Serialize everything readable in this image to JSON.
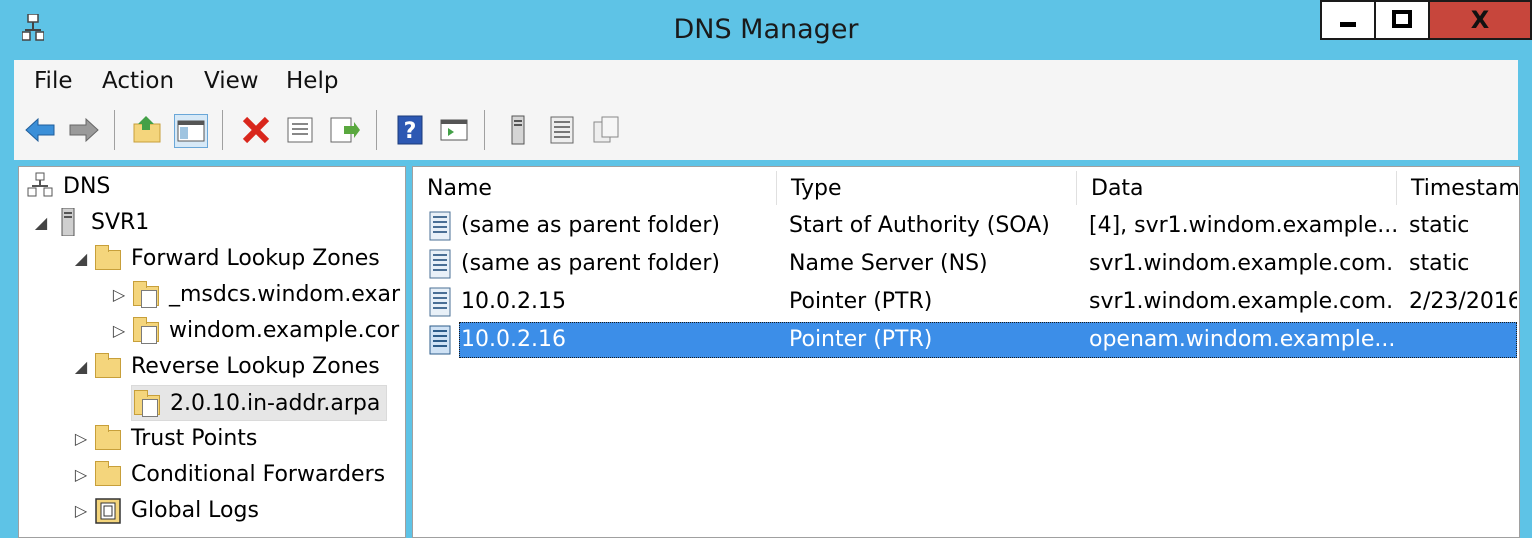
{
  "window": {
    "title": "DNS Manager",
    "min_label": "▬",
    "max_label": "☐",
    "close_label": "X"
  },
  "menu": [
    "File",
    "Action",
    "View",
    "Help"
  ],
  "toolbar": {
    "icons": [
      "back-arrow-icon",
      "forward-arrow-icon",
      "up-folder-icon",
      "show-hide-console-tree-icon",
      "delete-icon",
      "properties-icon",
      "export-list-icon",
      "help-icon",
      "action-pane-icon",
      "server-icon",
      "record-list-icon",
      "copy-icon"
    ]
  },
  "tree": {
    "root": "DNS",
    "server": "SVR1",
    "forward_zones": "Forward Lookup Zones",
    "forward_children": [
      "_msdcs.windom.exar",
      "windom.example.cor"
    ],
    "reverse_zones": "Reverse Lookup Zones",
    "reverse_children": [
      "2.0.10.in-addr.arpa"
    ],
    "trust_points": "Trust Points",
    "conditional_forwarders": "Conditional Forwarders",
    "global_logs": "Global Logs"
  },
  "list": {
    "columns": [
      "Name",
      "Type",
      "Data",
      "Timestam"
    ],
    "rows": [
      {
        "name": "(same as parent folder)",
        "type": "Start of Authority (SOA)",
        "data": "[4], svr1.windom.example....",
        "timestamp": "static"
      },
      {
        "name": "(same as parent folder)",
        "type": "Name Server (NS)",
        "data": "svr1.windom.example.com.",
        "timestamp": "static"
      },
      {
        "name": "10.0.2.15",
        "type": "Pointer (PTR)",
        "data": "svr1.windom.example.com.",
        "timestamp": "2/23/2016"
      },
      {
        "name": "10.0.2.16",
        "type": "Pointer (PTR)",
        "data": "openam.windom.example...",
        "timestamp": ""
      }
    ],
    "selected_index": 3
  },
  "colors": {
    "title_bar": "#5ec3e6",
    "selection": "#3c8ee8",
    "close_button": "#c7463c"
  }
}
